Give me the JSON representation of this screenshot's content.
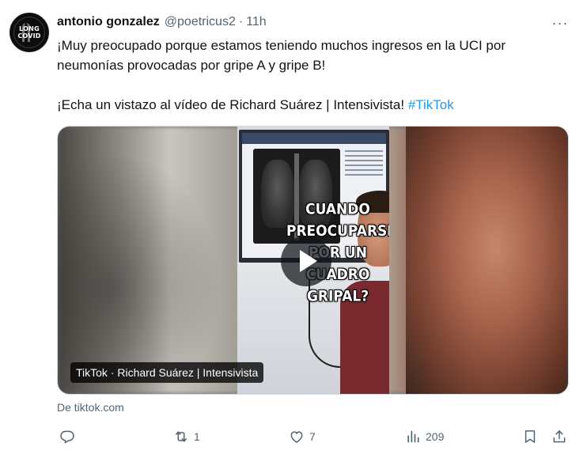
{
  "author": {
    "name": "antonio gonzalez",
    "handle": "@poetricus2",
    "separator": "·",
    "time": "11h",
    "avatar_text_1": "LONG",
    "avatar_text_2": "COVID"
  },
  "more_icon": "···",
  "tweet": {
    "line1": "¡Muy preocupado porque estamos teniendo muchos ingresos en la UCI por",
    "line2": "neumonías provocadas por gripe A y gripe B!",
    "line3_text": "¡Echa un vistazo al vídeo de Richard Suárez | Intensivista! ",
    "hashtag": "#TikTok"
  },
  "media": {
    "overlay_lines": [
      "CUANDO",
      "PREOCUPARSE",
      "POR UN",
      "CUADRO",
      "GRIPAL?"
    ],
    "caption": "TikTok · Richard Suárez | Intensivista",
    "play_icon": "play-icon"
  },
  "source": "De tiktok.com",
  "actions": {
    "reply": {
      "icon": "reply-icon",
      "count": ""
    },
    "retweet": {
      "icon": "retweet-icon",
      "count": "1"
    },
    "like": {
      "icon": "heart-icon",
      "count": "7"
    },
    "views": {
      "icon": "views-icon",
      "count": "209"
    },
    "bookmark": {
      "icon": "bookmark-icon"
    },
    "share": {
      "icon": "share-icon"
    }
  },
  "colors": {
    "link": "#1d9bf0",
    "secondary_text": "#536471",
    "primary_text": "#0f1419"
  }
}
